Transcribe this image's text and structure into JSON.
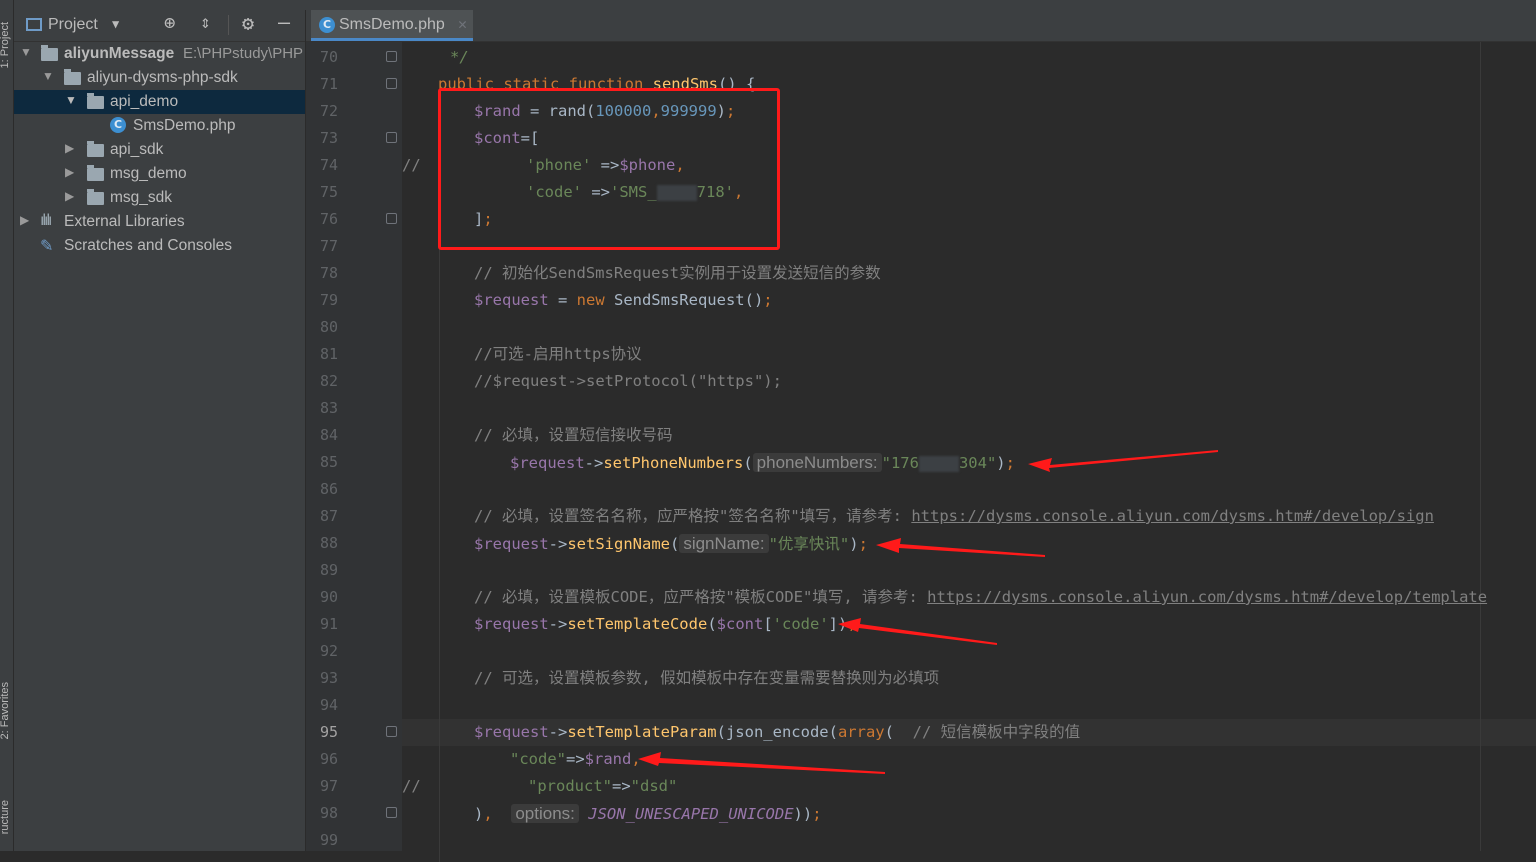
{
  "sidebar": {
    "project_tab": "1: Project",
    "favorites_tab": "2: Favorites",
    "structure_tab": "ructure"
  },
  "project_panel": {
    "title": "Project",
    "tree": [
      {
        "label": "aliyunMessage",
        "path": "E:\\PHPstudy\\PHP"
      },
      {
        "label": "aliyun-dysms-php-sdk"
      },
      {
        "label": "api_demo"
      },
      {
        "label": "SmsDemo.php"
      },
      {
        "label": "api_sdk"
      },
      {
        "label": "msg_demo"
      },
      {
        "label": "msg_sdk"
      },
      {
        "label": "External Libraries"
      },
      {
        "label": "Scratches and Consoles"
      }
    ]
  },
  "editor": {
    "tab_label": "SmsDemo.php",
    "current_line": "95",
    "line_numbers": [
      "70",
      "71",
      "72",
      "73",
      "74",
      "75",
      "76",
      "77",
      "78",
      "79",
      "80",
      "81",
      "82",
      "83",
      "84",
      "85",
      "86",
      "87",
      "88",
      "89",
      "90",
      "91",
      "92",
      "93",
      "94",
      "95",
      "96",
      "97",
      "98",
      "99"
    ],
    "code": {
      "l70": "*/",
      "l71_a": "public static function ",
      "l71_b": "sendSms",
      "l71_c": "() {",
      "l72_a": "$rand",
      "l72_b": " = rand(",
      "l72_c": "100000",
      "l72_d": ",",
      "l72_e": "999999",
      "l72_f": ")",
      "l72_g": ";",
      "l73_a": "$cont",
      "l73_b": "=[",
      "l74_comment": "//",
      "l74_a": "'phone'",
      "l74_b": " =>",
      "l74_c": "$phone",
      "l74_d": ",",
      "l75_a": "'code'",
      "l75_b": " =>",
      "l75_c": "'SMS_",
      "l75_d": "718'",
      "l75_e": ",",
      "l76_a": "]",
      "l76_b": ";",
      "l78": "// 初始化SendSmsRequest实例用于设置发送短信的参数",
      "l79_a": "$request",
      "l79_b": " = ",
      "l79_c": "new ",
      "l79_d": "SendSmsRequest()",
      "l79_e": ";",
      "l81": "//可选-启用https协议",
      "l82": "//$request->setProtocol(\"https\");",
      "l84": "// 必填，设置短信接收号码",
      "l85_a": "$request",
      "l85_b": "->",
      "l85_c": "setPhoneNumbers",
      "l85_d": "(",
      "l85_hint": "phoneNumbers:",
      "l85_e": "\"176",
      "l85_f": "304\"",
      "l85_g": ")",
      "l85_h": ";",
      "l87_a": "// 必填，设置签名名称，应严格按\"签名名称\"填写，请参考: ",
      "l87_link": "https://dysms.console.aliyun.com/dysms.htm#/develop/sign",
      "l88_a": "$request",
      "l88_b": "->",
      "l88_c": "setSignName",
      "l88_d": "(",
      "l88_hint": "signName:",
      "l88_e": "\"优享快讯\"",
      "l88_f": ")",
      "l88_g": ";",
      "l90_a": "// 必填，设置模板CODE，应严格按\"模板CODE\"填写, 请参考: ",
      "l90_link": "https://dysms.console.aliyun.com/dysms.htm#/develop/template",
      "l91_a": "$request",
      "l91_b": "->",
      "l91_c": "setTemplateCode",
      "l91_d": "(",
      "l91_e": "$cont",
      "l91_f": "[",
      "l91_g": "'code'",
      "l91_h": "])",
      "l91_i": ";",
      "l93": "// 可选，设置模板参数, 假如模板中存在变量需要替换则为必填项",
      "l95_a": "$request",
      "l95_b": "->",
      "l95_c": "setTemplateParam",
      "l95_d": "(json_encode(",
      "l95_e": "array",
      "l95_f": "(  ",
      "l95_g": "// 短信模板中字段的值",
      "l96_a": "\"code\"",
      "l96_b": "=>",
      "l96_c": "$rand",
      "l96_d": ",",
      "l97_comment": "//",
      "l97_a": "\"product\"",
      "l97_b": "=>",
      "l97_c": "\"dsd\"",
      "l98_a": ")",
      "l98_b": ",  ",
      "l98_hint": "options:",
      "l98_c": "JSON_UNESCAPED_UNICODE",
      "l98_d": "))",
      "l98_e": ";"
    }
  },
  "colors": {
    "annotation": "#ff1a1a",
    "keyword": "#cc7832",
    "variable": "#9876aa",
    "string": "#6a8759",
    "number": "#6897bb",
    "comment": "#808080",
    "function": "#ffc66d"
  }
}
